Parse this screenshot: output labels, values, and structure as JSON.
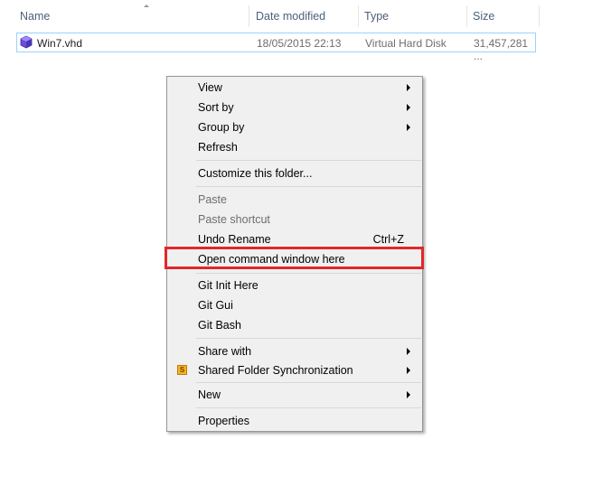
{
  "columns": {
    "name": "Name",
    "date_modified": "Date modified",
    "type": "Type",
    "size": "Size"
  },
  "file": {
    "name": "Win7.vhd",
    "date_modified": "18/05/2015 22:13",
    "type": "Virtual Hard Disk",
    "size": "31,457,281 ...",
    "icon": "vhd-file-icon"
  },
  "context_menu": {
    "view": "View",
    "sort_by": "Sort by",
    "group_by": "Group by",
    "refresh": "Refresh",
    "customize": "Customize this folder...",
    "paste": "Paste",
    "paste_shortcut": "Paste shortcut",
    "undo_rename": "Undo Rename",
    "undo_shortcut": "Ctrl+Z",
    "open_cmd": "Open command window here",
    "git_init": "Git Init Here",
    "git_gui": "Git Gui",
    "git_bash": "Git Bash",
    "share_with": "Share with",
    "shared_sync": "Shared Folder Synchronization",
    "shared_sync_icon_letter": "S",
    "new": "New",
    "properties": "Properties"
  },
  "colors": {
    "highlight_box": "#e3262b",
    "selection_border": "#99d1ff",
    "menu_background": "#f0f0f0"
  }
}
